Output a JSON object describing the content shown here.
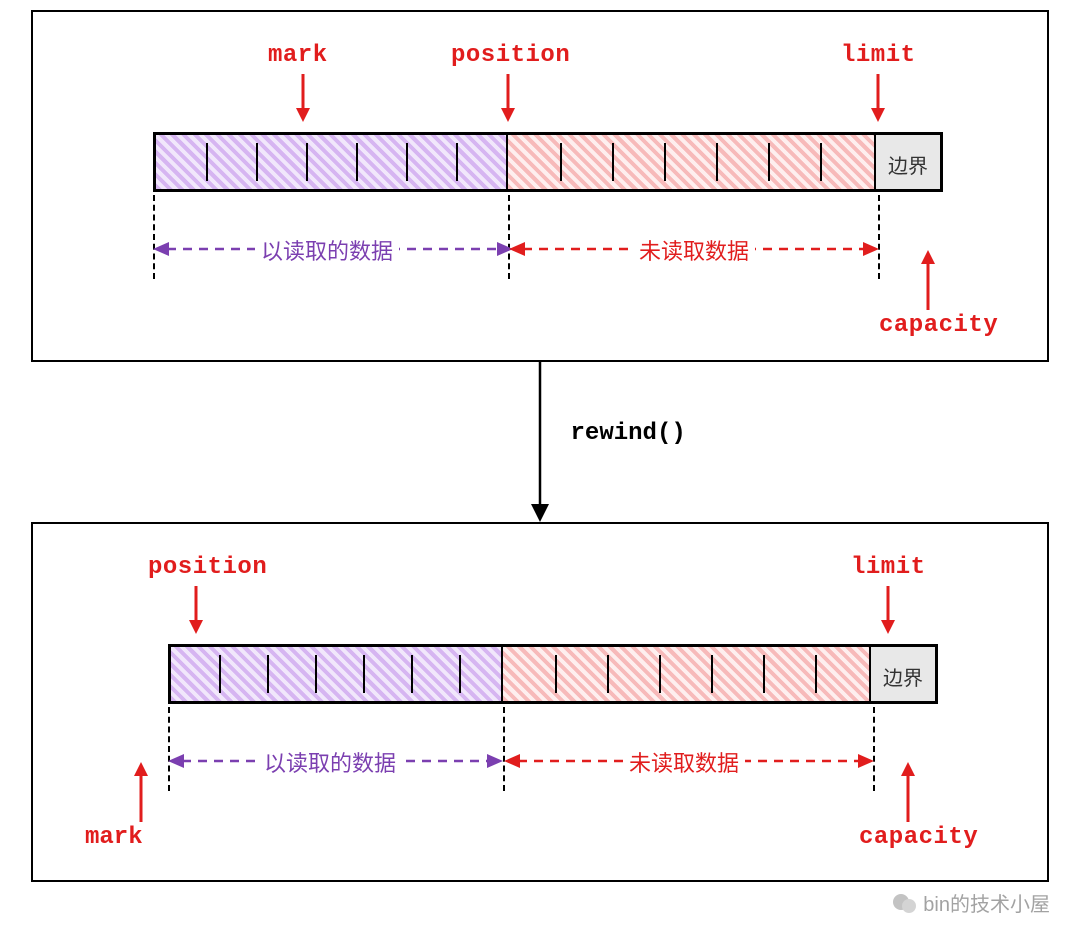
{
  "top": {
    "pointers": {
      "mark": "mark",
      "position": "position",
      "limit": "limit",
      "capacity": "capacity"
    },
    "ranges": {
      "read": "以读取的数据",
      "unread": "未读取数据"
    },
    "buffer": {
      "purple_cells": 7,
      "red_cells": 7,
      "boundary_label": "边界"
    }
  },
  "transition": {
    "label": "rewind()"
  },
  "bottom": {
    "pointers": {
      "mark": "mark",
      "position": "position",
      "limit": "limit",
      "capacity": "capacity"
    },
    "ranges": {
      "read": "以读取的数据",
      "unread": "未读取数据"
    },
    "buffer": {
      "purple_cells": 7,
      "red_cells": 7,
      "boundary_label": "边界"
    }
  },
  "watermark": "bin的技术小屋"
}
